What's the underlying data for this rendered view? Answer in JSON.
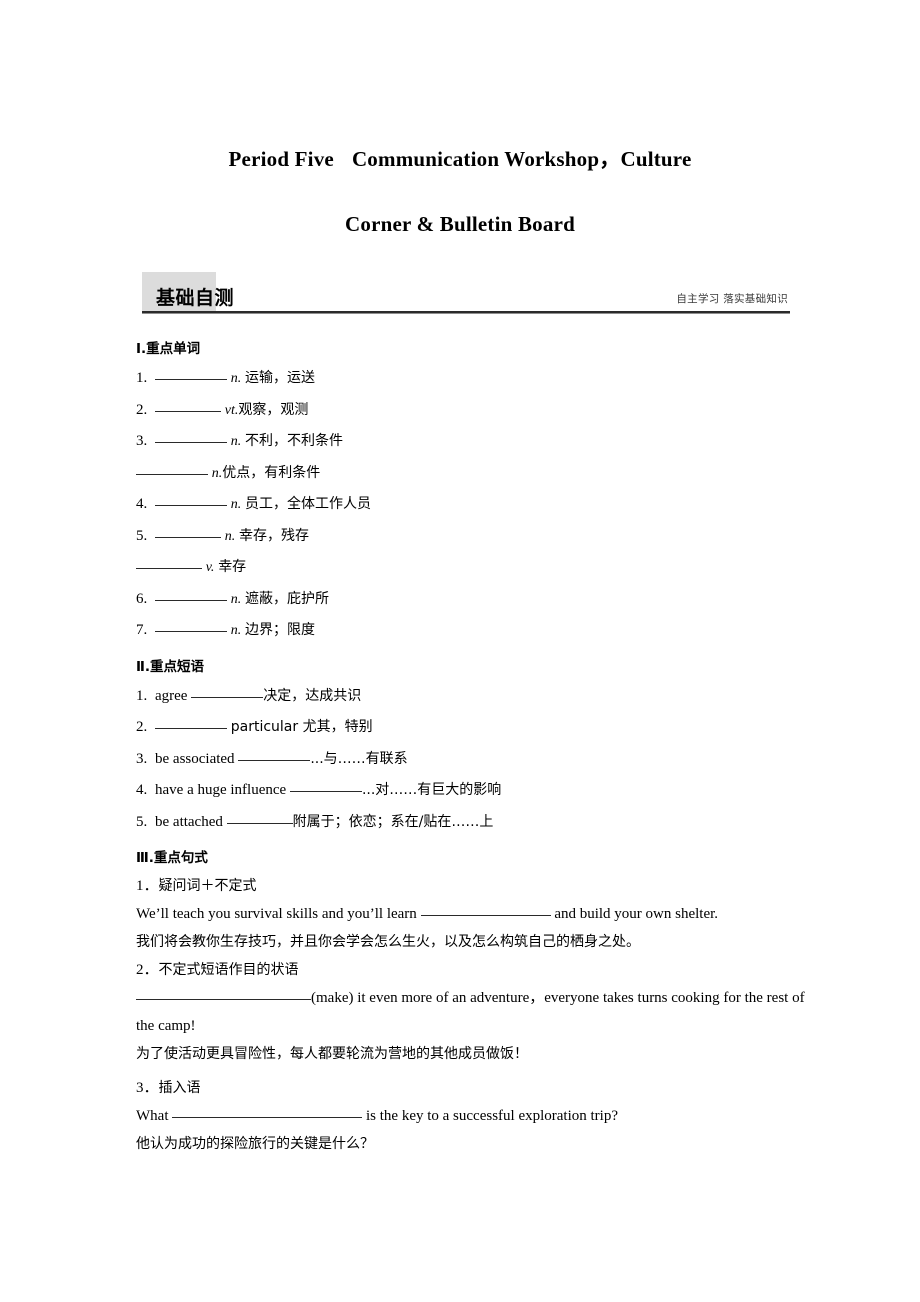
{
  "title": {
    "line1_a": "Period Five",
    "line1_b": "Communication Workshop，Culture",
    "line2": "Corner & Bulletin Board"
  },
  "band": {
    "heading": "基础自测",
    "subheading": "自主学习  落实基础知识",
    "highlight_color": "#dcdcdc",
    "rule_color": "#2b2b2b"
  },
  "sections": {
    "words": {
      "heading": "Ⅰ.重点单词",
      "items": [
        {
          "num": "1.",
          "blank": "",
          "pos": "n.",
          "meaning": "运输，运送"
        },
        {
          "num": "2.",
          "blank": "",
          "pos": "vt.",
          "meaning": "观察，观测"
        },
        {
          "num": "3.",
          "blank": "",
          "pos": "n.",
          "meaning": "不利，不利条件"
        },
        {
          "num": "",
          "blank": "",
          "pos": "n.",
          "meaning": "优点，有利条件"
        },
        {
          "num": "4.",
          "blank": "",
          "pos": "n.",
          "meaning": "员工，全体工作人员"
        },
        {
          "num": "5.",
          "blank": "",
          "pos": "n.",
          "meaning": "幸存，残存"
        },
        {
          "num": "",
          "blank": "",
          "pos": "v.",
          "meaning": "幸存"
        },
        {
          "num": "6.",
          "blank": "",
          "pos": "n.",
          "meaning": "遮蔽，庇护所"
        },
        {
          "num": "7.",
          "blank": "",
          "pos": "n.",
          "meaning": "边界；限度"
        }
      ]
    },
    "phrases": {
      "heading": "Ⅱ.重点短语",
      "items": [
        {
          "num": "1.",
          "before": "agree",
          "after": "决定，达成共识"
        },
        {
          "num": "2.",
          "before": "",
          "after": "particular 尤其，特别"
        },
        {
          "num": "3.",
          "before": "be associated",
          "after": "...与……有联系"
        },
        {
          "num": "4.",
          "before": "have a huge influence",
          "after": "...对……有巨大的影响"
        },
        {
          "num": "5.",
          "before": "be attached",
          "after": "附属于；依恋；系在/贴在……上"
        }
      ]
    },
    "patterns": {
      "heading": "Ⅲ.重点句式",
      "items": [
        {
          "num": "1．",
          "label": "疑问词＋不定式",
          "en_before": "We’ll teach you survival skills and you’ll learn",
          "en_after": "and build your own shelter.",
          "cn": "我们将会教你生存技巧，并且你会学会怎么生火，以及怎么构筑自己的栖身之处。"
        },
        {
          "num": "2．",
          "label": "不定式短语作目的状语",
          "en_before": "",
          "en_after": "(make) it even more of an adventure，everyone takes turns cooking for the rest of the camp!",
          "cn": "为了使活动更具冒险性，每人都要轮流为营地的其他成员做饭！"
        },
        {
          "num": "3．",
          "label": "插入语",
          "en_before": "What",
          "en_after": "is the key to a successful exploration trip?",
          "cn": "他认为成功的探险旅行的关键是什么？"
        }
      ]
    }
  }
}
